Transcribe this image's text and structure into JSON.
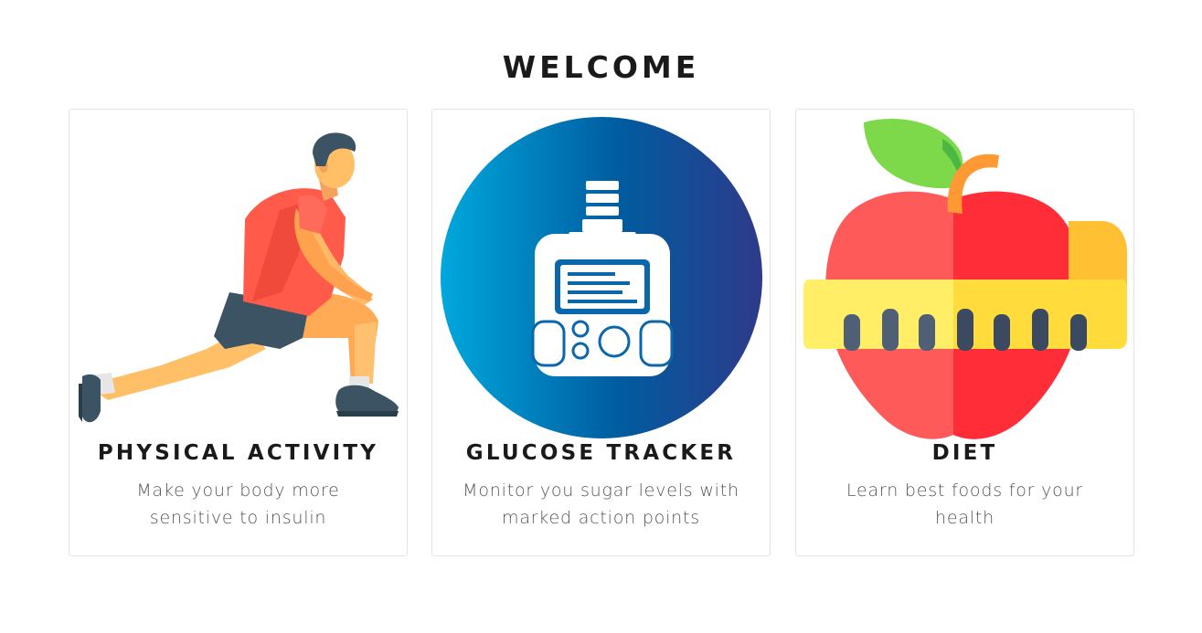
{
  "page": {
    "title": "WELCOME"
  },
  "cards": [
    {
      "title": "PHYSICAL ACTIVITY",
      "description": "Make your body more sensitive to insulin",
      "icon": "stretching-man-icon"
    },
    {
      "title": "GLUCOSE TRACKER",
      "description": "Monitor you sugar levels with marked action points",
      "icon": "glucose-meter-icon"
    },
    {
      "title": "DIET",
      "description": "Learn best foods for your health",
      "icon": "apple-measuring-tape-icon"
    }
  ],
  "colors": {
    "title_text": "#1a1a1a",
    "body_text": "#555555",
    "card_border": "#e3e3e3",
    "glucose_gradient_start": "#00a8dd",
    "glucose_gradient_end": "#2e3a8a",
    "apple_red": "#ff3a3a",
    "tape_yellow": "#ffe14d",
    "shirt_red": "#ff5a4a"
  }
}
